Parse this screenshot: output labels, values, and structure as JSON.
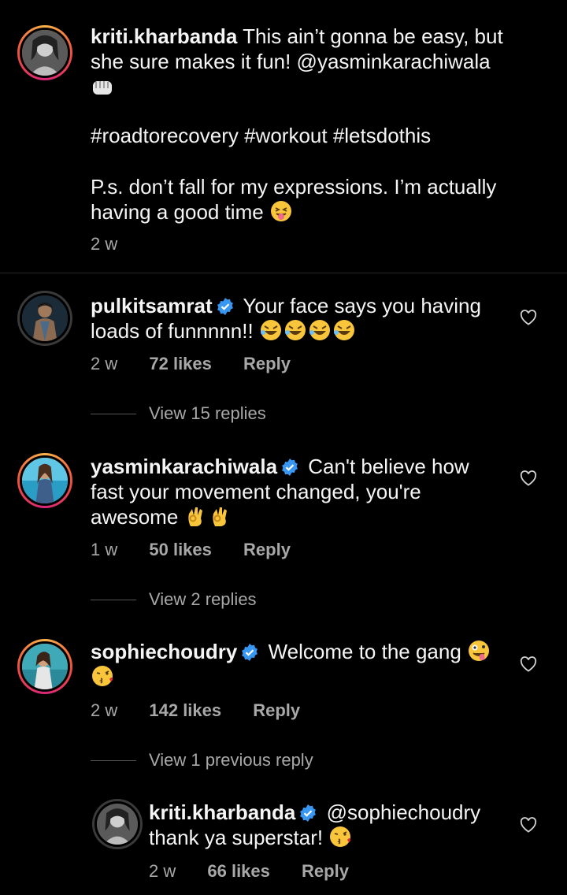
{
  "caption": {
    "username": "kriti.kharbanda",
    "text": "This ain’t gonna be easy, but she sure makes it fun! @yasminkarachiwala",
    "hashtags": "#roadtorecovery #workout #letsdothis",
    "ps_line1": "P.s. don’t fall for my expressions. I’m actually",
    "ps_line2": "having a good time",
    "time": "2 w"
  },
  "comments": [
    {
      "username": "pulkitsamrat",
      "text_line1": "Your face says you having",
      "text_line2": "loads of funnnnn!!",
      "time": "2 w",
      "likes": "72 likes",
      "reply": "Reply",
      "view_replies": "View 15 replies"
    },
    {
      "username": "yasminkarachiwala",
      "text_line1": "Can't believe how",
      "text_line2": "fast your movement changed, you're",
      "text_line3": "awesome",
      "time": "1 w",
      "likes": "50 likes",
      "reply": "Reply",
      "view_replies": "View 2 replies"
    },
    {
      "username": "sophiechoudry",
      "text_line1": "Welcome to the gang",
      "time": "2 w",
      "likes": "142 likes",
      "reply": "Reply",
      "view_replies": "View 1 previous reply"
    }
  ],
  "reply": {
    "username": "kriti.kharbanda",
    "mention": "@sophiechoudry",
    "text": "thank ya superstar!",
    "time": "2 w",
    "likes": "66 likes",
    "reply": "Reply"
  },
  "colors": {
    "background": "#000000",
    "text": "#f5f5f5",
    "secondary": "#a8a8a8",
    "verified": "#3897f0"
  }
}
